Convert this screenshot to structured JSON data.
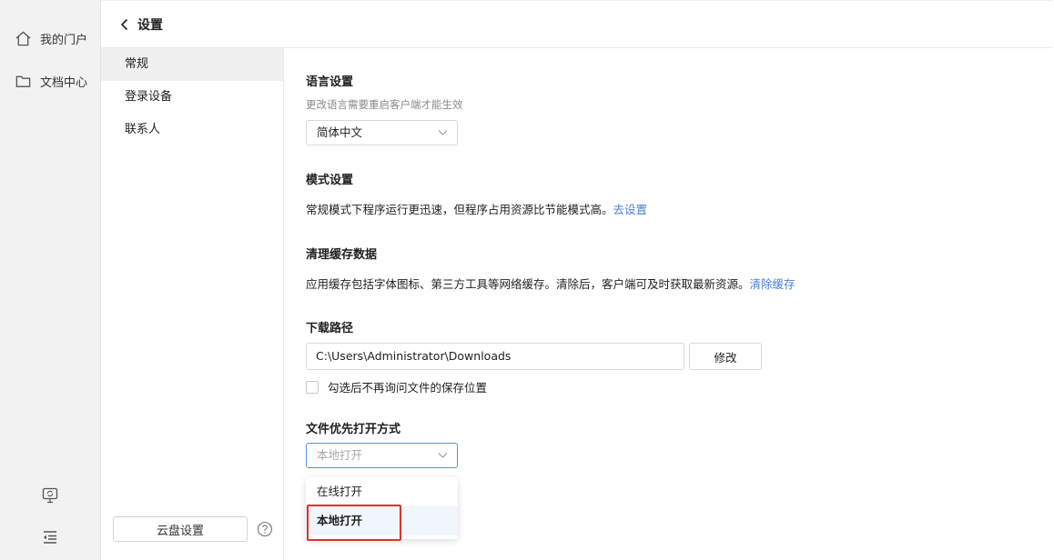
{
  "rail": {
    "items": [
      {
        "label": "我的门户",
        "icon": "home-icon"
      },
      {
        "label": "文档中心",
        "icon": "folder-icon"
      }
    ],
    "bottom_icons": [
      "sync-screen-icon",
      "collapse-menu-icon"
    ]
  },
  "header": {
    "title": "设置"
  },
  "subnav": {
    "items": [
      {
        "label": "常规",
        "active": true
      },
      {
        "label": "登录设备",
        "active": false
      },
      {
        "label": "联系人",
        "active": false
      }
    ],
    "cloud_button": "云盘设置"
  },
  "language": {
    "title": "语言设置",
    "desc": "更改语言需要重启客户端才能生效",
    "value": "简体中文"
  },
  "mode": {
    "title": "模式设置",
    "text": "常规模式下程序运行更迅速，但程序占用资源比节能模式高。",
    "link": "去设置"
  },
  "cache": {
    "title": "清理缓存数据",
    "text": "应用缓存包括字体图标、第三方工具等网络缓存。清除后，客户端可及时获取最新资源。",
    "link": "清除缓存"
  },
  "download": {
    "title": "下载路径",
    "path": "C:\\Users\\Administrator\\Downloads",
    "modify_button": "修改",
    "checkbox_label": "勾选后不再询问文件的保存位置",
    "checkbox_checked": false
  },
  "open_mode": {
    "title": "文件优先打开方式",
    "placeholder": "本地打开",
    "options": [
      {
        "label": "在线打开",
        "selected": false
      },
      {
        "label": "本地打开",
        "selected": true
      }
    ]
  },
  "colors": {
    "accent": "#4a7fd6",
    "focus_border": "#5b8ff0",
    "highlight": "#e0312b"
  }
}
